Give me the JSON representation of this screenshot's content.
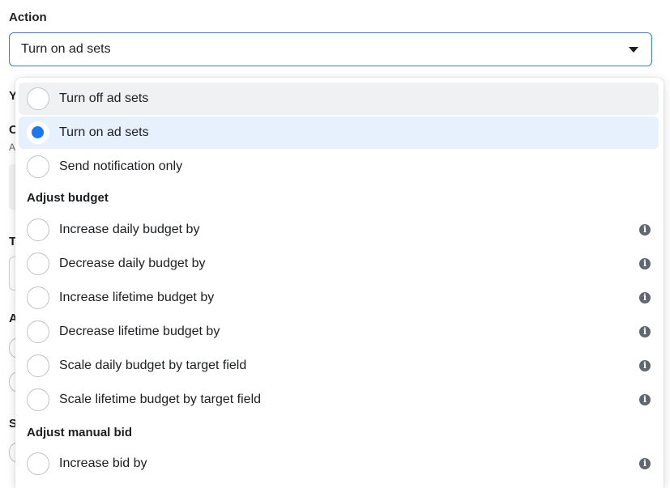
{
  "section": {
    "label": "Action"
  },
  "select": {
    "value": "Turn on ad sets"
  },
  "background": {
    "fragments": [
      "Y",
      "C",
      "A",
      "T",
      "A",
      "S"
    ]
  },
  "dropdown": {
    "options_top": [
      {
        "label": "Turn off ad sets"
      },
      {
        "label": "Turn on ad sets"
      },
      {
        "label": "Send notification only"
      }
    ],
    "groups": [
      {
        "header": "Adjust budget",
        "options": [
          {
            "label": "Increase daily budget by"
          },
          {
            "label": "Decrease daily budget by"
          },
          {
            "label": "Increase lifetime budget by"
          },
          {
            "label": "Decrease lifetime budget by"
          },
          {
            "label": "Scale daily budget by target field"
          },
          {
            "label": "Scale lifetime budget by target field"
          }
        ]
      },
      {
        "header": "Adjust manual bid",
        "options": [
          {
            "label": "Increase bid by"
          }
        ]
      }
    ],
    "selected": "Turn on ad sets",
    "info_glyph": "i"
  },
  "colors": {
    "accent": "#1877f2",
    "focus_border": "#3578e5",
    "selected_bg": "#e7f0fd",
    "hover_bg": "#f0f1f3"
  }
}
